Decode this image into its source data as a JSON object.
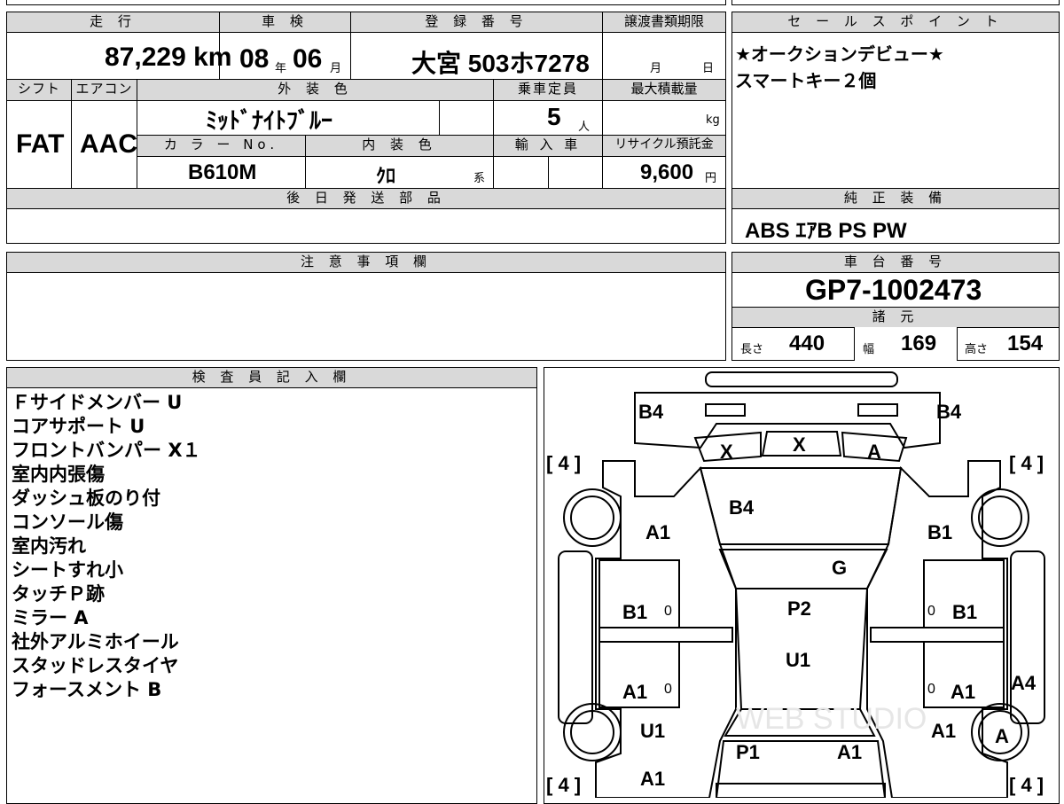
{
  "headers": {
    "mileage": "走 行",
    "inspection": "車 検",
    "registration": "登 録 番 号",
    "transfer_deadline": "譲渡書類期限",
    "shift": "シフト",
    "aircon": "エアコン",
    "exterior_color": "外 装 色",
    "capacity": "乗車定員",
    "max_load": "最大積載量",
    "color_no": "カ ラ ー No.",
    "interior_color": "内 装 色",
    "import": "輸 入 車",
    "recycle": "リサイクル預託金",
    "later_parts": "後 日 発 送 部 品",
    "sales_points": "セ ー ル ス ポ イ ン ト",
    "genuine_equipment": "純 正 装 備",
    "notes": "注 意 事 項 欄",
    "chassis_no": "車 台 番 号",
    "specs": "諸 元",
    "inspector": "検 査 員 記 入 欄"
  },
  "vehicle": {
    "mileage": "87,229 km",
    "inspection_year": "08",
    "inspection_year_unit": "年",
    "inspection_month": "06",
    "inspection_month_unit": "月",
    "registration": "大宮 503ホ7278",
    "deadline_month_unit": "月",
    "deadline_day_unit": "日",
    "shift": "FAT",
    "aircon": "AAC",
    "exterior_color": "ﾐｯﾄﾞﾅｲﾄﾌﾞﾙｰ",
    "capacity": "5",
    "capacity_unit": "人",
    "max_load_unit": "kg",
    "color_no": "B610M",
    "interior_color": "ｸﾛ",
    "interior_color_suffix": "系",
    "recycle_fee": "9,600",
    "recycle_unit": "円",
    "chassis_no": "GP7-1002473"
  },
  "sales_points": [
    "★オークションデビュー★",
    "スマートキー２個"
  ],
  "genuine_equipment": "ABS ｴｱB PS PW",
  "specs": {
    "length_label": "長さ",
    "length": "440",
    "width_label": "幅",
    "width": "169",
    "height_label": "高さ",
    "height": "154"
  },
  "inspector_notes": [
    "Ｆサイドメンバー U",
    "コアサポート U",
    "フロントバンパー X１",
    "室内内張傷",
    "ダッシュ板のり付",
    "コンソール傷",
    "室内汚れ",
    "シートすれ小",
    "タッチＰ跡",
    "ミラー A",
    "社外アルミホイール",
    "スタッドレスタイヤ",
    "フォースメント B"
  ],
  "diagram": {
    "watermark": "WEB STUDIO",
    "tread_fl": "[ 4 ]",
    "tread_fr": "[ 4 ]",
    "tread_rl": "[ 4 ]",
    "tread_rr": "[ 4 ]",
    "zero": "0",
    "marks": {
      "headlight_left": "B4",
      "headlight_right": "B4",
      "grille_left": "X",
      "grille_center": "X",
      "grille_right": "A",
      "hood": "B4",
      "front_fender_left": "A1",
      "front_fender_right": "B1",
      "windshield": "G",
      "front_door_left": "B1",
      "front_door_right": "B1",
      "roof": "P2",
      "center": "U1",
      "rear_door_left": "A1",
      "rear_door_right": "A1",
      "rear_pillar_right": "A4",
      "rear_fender_left": "U1",
      "rear_fender_right": "A1",
      "rear_left": "P1",
      "rear_right": "A1",
      "rear_bottom_left": "A1",
      "rear_wheel_right": "A"
    }
  }
}
